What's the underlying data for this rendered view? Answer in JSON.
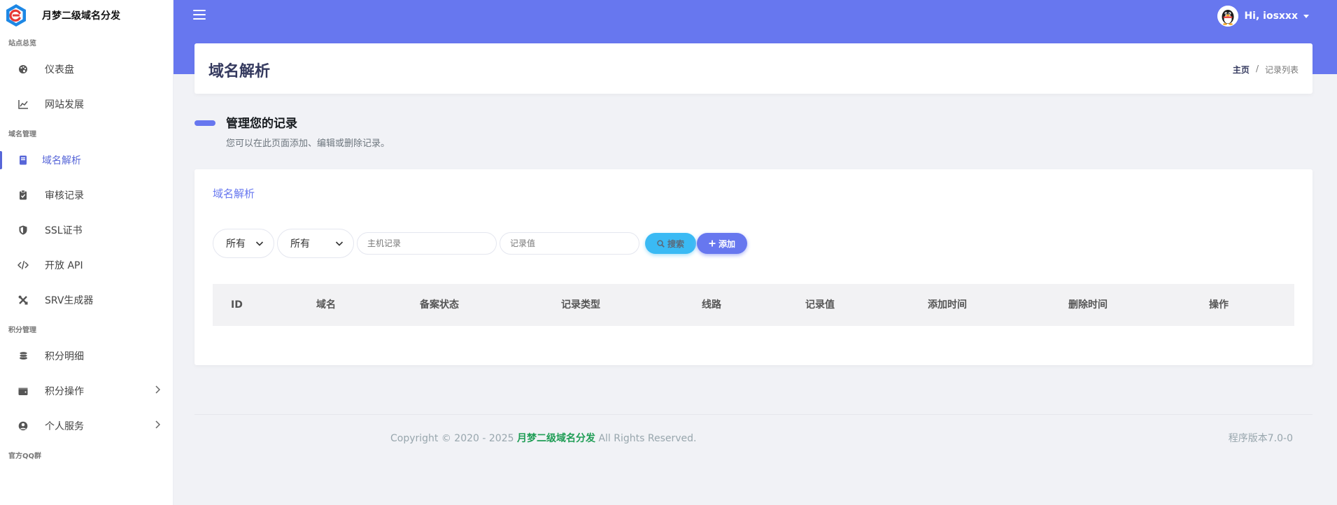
{
  "brand": {
    "name": "月梦二级域名分发"
  },
  "sidebar": {
    "groups": [
      {
        "title": "站点总览",
        "items": [
          {
            "label": "仪表盘",
            "icon": "palette-icon"
          },
          {
            "label": "网站发展",
            "icon": "chart-line-icon"
          }
        ]
      },
      {
        "title": "域名管理",
        "items": [
          {
            "label": "域名解析",
            "icon": "book-icon",
            "active": true
          },
          {
            "label": "审核记录",
            "icon": "clipboard-check-icon"
          },
          {
            "label": "SSL证书",
            "icon": "shield-icon"
          },
          {
            "label": "开放 API",
            "icon": "code-icon"
          },
          {
            "label": "SRV生成器",
            "icon": "tools-icon"
          }
        ]
      },
      {
        "title": "积分管理",
        "items": [
          {
            "label": "积分明细",
            "icon": "coins-icon"
          },
          {
            "label": "积分操作",
            "icon": "wallet-icon",
            "expandable": true
          },
          {
            "label": "个人服务",
            "icon": "user-circle-icon",
            "expandable": true
          }
        ]
      },
      {
        "title": "官方QQ群",
        "items": []
      }
    ]
  },
  "header": {
    "user_greeting": "Hi, iosxxx",
    "accent_color": "#6777ef"
  },
  "page": {
    "title": "域名解析",
    "breadcrumb": {
      "home": "主页",
      "separator": "/",
      "current": "记录列表"
    }
  },
  "section": {
    "title": "管理您的记录",
    "description": "您可以在此页面添加、编辑或删除记录。"
  },
  "card": {
    "title": "域名解析",
    "filters": {
      "select_1": "所有",
      "select_2": "所有",
      "host_placeholder": "主机记录",
      "value_placeholder": "记录值",
      "search_label": "搜索",
      "add_label": "添加"
    },
    "table": {
      "columns": [
        "ID",
        "域名",
        "备案状态",
        "记录类型",
        "线路",
        "记录值",
        "添加时间",
        "删除时间",
        "操作"
      ]
    }
  },
  "footer": {
    "copyright_prefix": "Copyright © 2020 - 2025",
    "copyright_brand": "月梦二级域名分发",
    "copyright_suffix": "All Rights Reserved.",
    "version": "程序版本7.0-0"
  }
}
